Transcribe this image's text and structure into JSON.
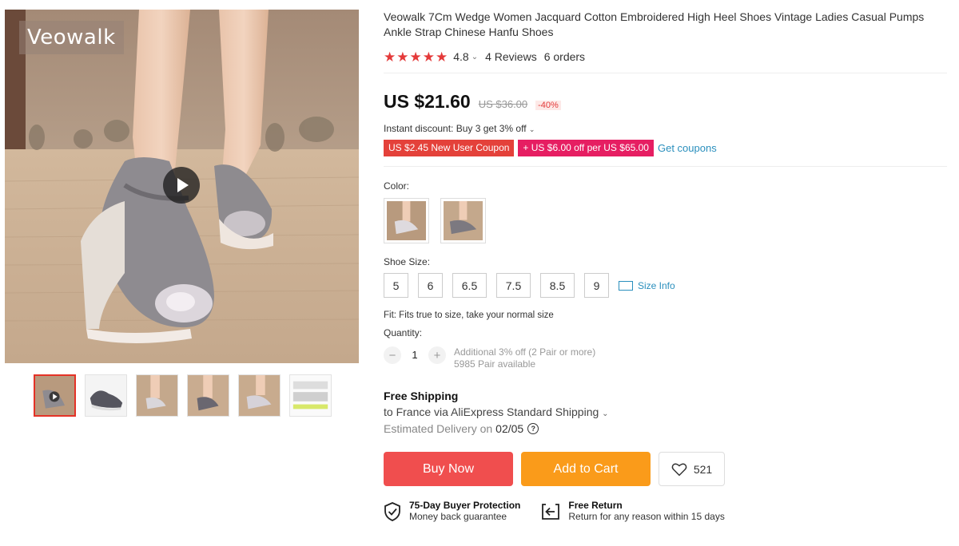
{
  "gallery": {
    "brand_logo": "Veowalk",
    "main_icon": "play-icon",
    "thumbnail_count": 6,
    "active_thumbnail": 1
  },
  "product": {
    "title": "Veowalk 7Cm Wedge Women Jacquard Cotton Embroidered High Heel Shoes Vintage Ladies Casual Pumps Ankle Strap Chinese Hanfu Shoes",
    "rating": "4.8",
    "stars": 5,
    "reviews": "4 Reviews",
    "orders": "6 orders"
  },
  "price": {
    "current": "US $21.60",
    "original": "US $36.00",
    "discount": "-40%"
  },
  "promotions": {
    "instant_discount": "Instant discount: Buy 3 get 3% off",
    "coupon_new_user": "US $2.45 New User Coupon",
    "coupon_spend": "+ US $6.00 off per US $65.00",
    "get_coupons": "Get coupons"
  },
  "options": {
    "color_label": "Color:",
    "size_label": "Shoe Size:",
    "sizes": [
      "5",
      "6",
      "6.5",
      "7.5",
      "8.5",
      "9"
    ],
    "size_info": "Size Info",
    "fit_note": "Fit: Fits true to size, take your normal size"
  },
  "quantity": {
    "label": "Quantity:",
    "value": "1",
    "minus": "−",
    "plus": "+",
    "additional": "Additional 3% off (2 Pair or more)",
    "available": "5985 Pair available"
  },
  "shipping": {
    "title": "Free Shipping",
    "destination": "to France via AliExpress Standard Shipping",
    "estimated_label": "Estimated Delivery on",
    "estimated_date": "02/05"
  },
  "actions": {
    "buy_now": "Buy Now",
    "add_to_cart": "Add to Cart",
    "wishlist_count": "521"
  },
  "guarantees": {
    "protection_title": "75-Day Buyer Protection",
    "protection_sub": "Money back guarantee",
    "return_title": "Free Return",
    "return_sub": "Return for any reason within 15 days"
  },
  "colors": {
    "price_red": "#e43a3a",
    "buy_now": "#f04e4e",
    "add_to_cart": "#fa9b1a",
    "link_blue": "#2a8fbd",
    "coupon_red": "#e4413a",
    "coupon_pink": "#e61e62"
  }
}
